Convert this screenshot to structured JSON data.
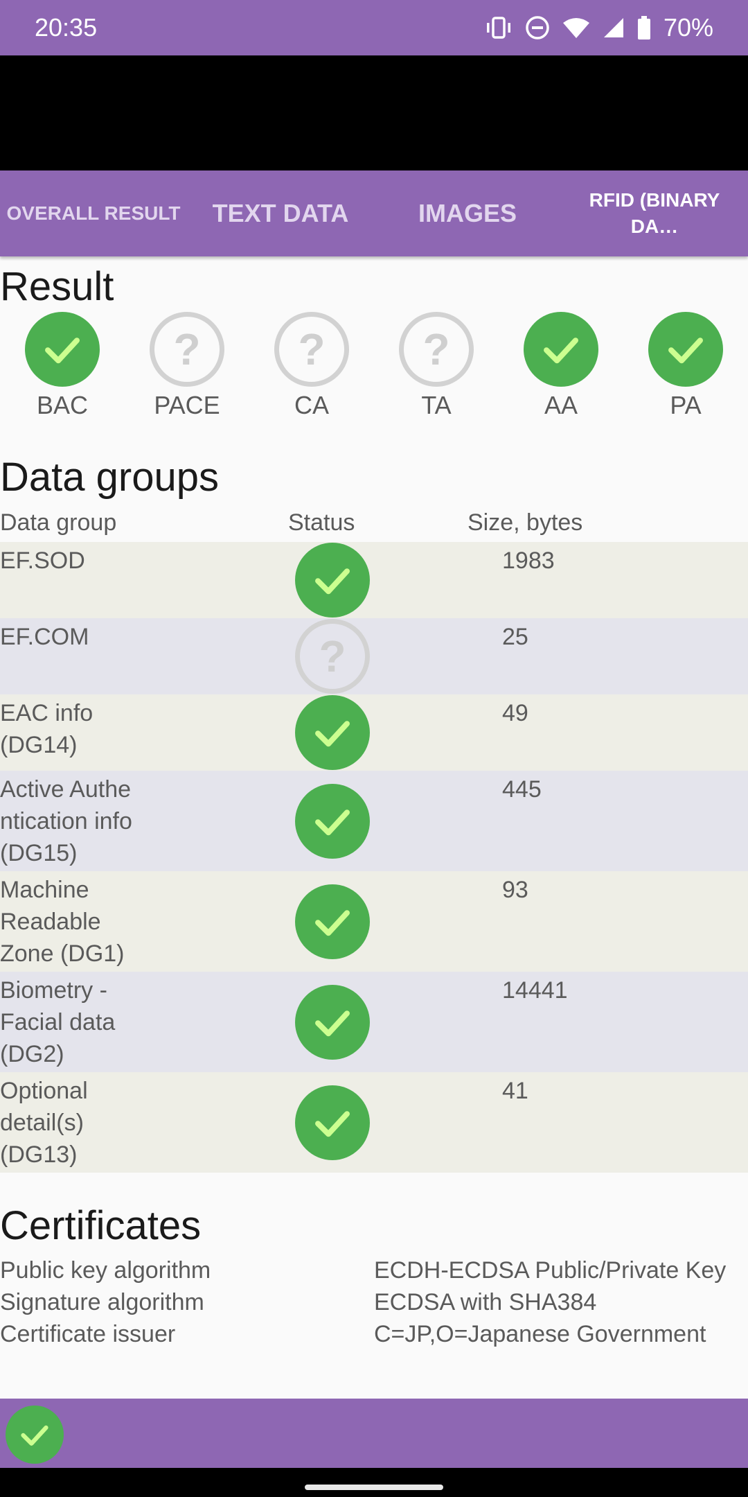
{
  "status_bar": {
    "time": "20:35",
    "battery": "70%"
  },
  "tabs": [
    {
      "label": "OVERALL RESULT"
    },
    {
      "label": "TEXT DATA"
    },
    {
      "label": "IMAGES"
    },
    {
      "label": "RFID (BINARY DA…"
    }
  ],
  "result": {
    "title": "Result",
    "items": [
      {
        "label": "BAC",
        "status": "ok"
      },
      {
        "label": "PACE",
        "status": "unknown"
      },
      {
        "label": "CA",
        "status": "unknown"
      },
      {
        "label": "TA",
        "status": "unknown"
      },
      {
        "label": "AA",
        "status": "ok"
      },
      {
        "label": "PA",
        "status": "ok"
      }
    ]
  },
  "data_groups": {
    "title": "Data groups",
    "headers": {
      "group": "Data group",
      "status": "Status",
      "size": "Size, bytes"
    },
    "rows": [
      {
        "name": "EF.SOD",
        "status": "ok",
        "size": "1983"
      },
      {
        "name": "EF.COM",
        "status": "unknown",
        "size": "25"
      },
      {
        "name": "EAC info (DG14)",
        "status": "ok",
        "size": "49"
      },
      {
        "name": "Active Authentication info (DG15)",
        "status": "ok",
        "size": "445"
      },
      {
        "name": "Machine Readable Zone (DG1)",
        "status": "ok",
        "size": "93"
      },
      {
        "name": "Biometry - Facial data (DG2)",
        "status": "ok",
        "size": "14441"
      },
      {
        "name": "Optional detail(s) (DG13)",
        "status": "ok",
        "size": "41"
      }
    ]
  },
  "certificates": {
    "title": "Certificates",
    "rows": [
      {
        "key": "Public key algorithm",
        "value": "ECDH-ECDSA Public/Private Key"
      },
      {
        "key": "Signature algorithm",
        "value": "ECDSA with SHA384"
      },
      {
        "key": "Certificate issuer",
        "value": "C=JP,O=Japanese Government"
      }
    ]
  },
  "overall_status": "ok",
  "colors": {
    "accent": "#8e67b3",
    "ok": "#4caf50",
    "check": "#ccff90",
    "unknown": "#d2d2d2"
  }
}
